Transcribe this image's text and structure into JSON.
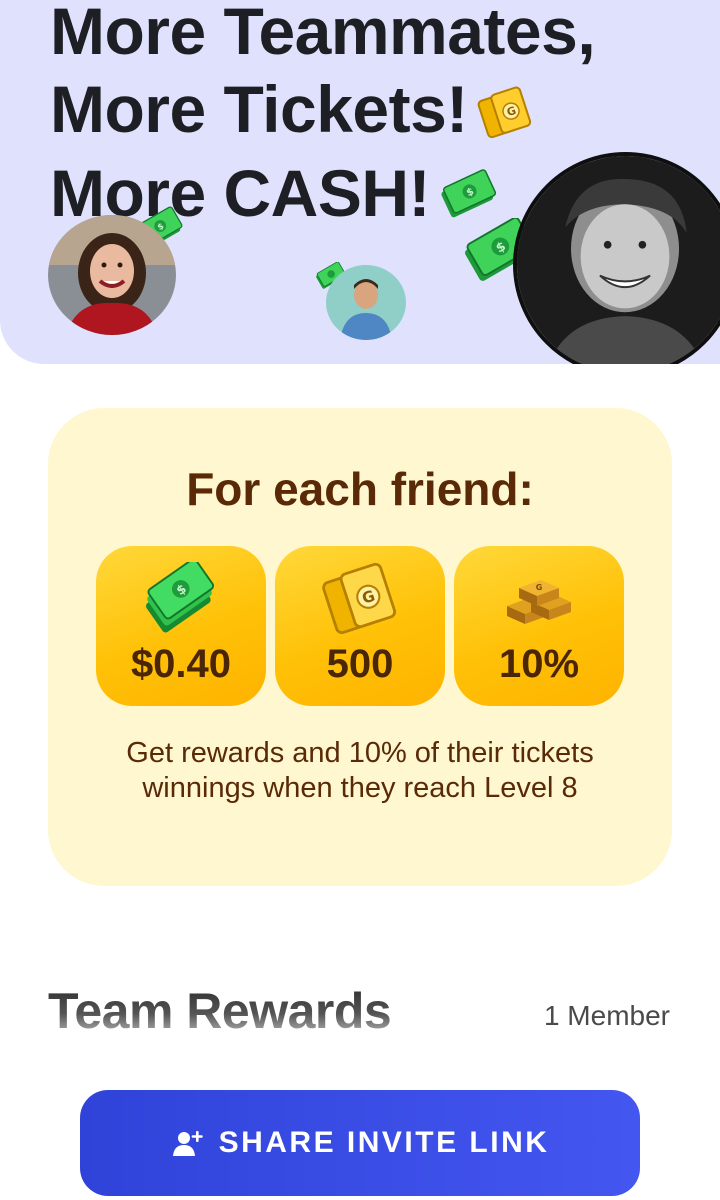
{
  "hero": {
    "line1": "More Teammates,",
    "line2": "More Tickets!",
    "line3": "More CASH!",
    "background": "#e0e2fd"
  },
  "rewards": {
    "title": "For each friend:",
    "tiles": [
      {
        "icon": "cash-icon",
        "value": "$0.40"
      },
      {
        "icon": "ticket-icon",
        "value": "500"
      },
      {
        "icon": "gold-bars-icon",
        "value": "10%"
      }
    ],
    "description": "Get rewards and 10% of their tickets winnings when they reach Level 8",
    "card_color": "#fff7cf",
    "tile_color": "#ffc107"
  },
  "team": {
    "title": "Team Rewards",
    "member_count": "1 Member"
  },
  "share_button": {
    "label": "SHARE INVITE LINK",
    "icon": "add-user-icon",
    "color": "#3a4de8"
  }
}
